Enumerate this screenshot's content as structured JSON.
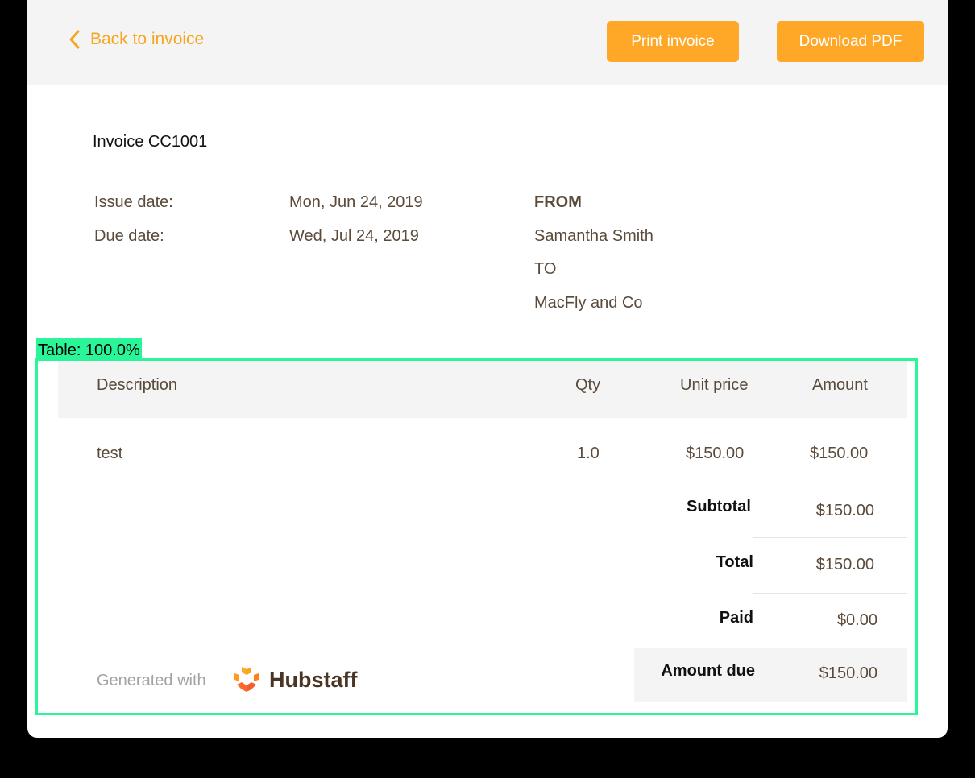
{
  "header": {
    "back_label": "Back to invoice",
    "print_label": "Print invoice",
    "download_label": "Download PDF"
  },
  "invoice": {
    "title": "Invoice CC1001",
    "issue_label": "Issue date:",
    "issue_value": "Mon, Jun 24, 2019",
    "due_label": "Due date:",
    "due_value": "Wed, Jul 24, 2019",
    "from_label": "FROM",
    "from_value": "Samantha Smith",
    "to_label": "TO",
    "to_value": "MacFly and Co"
  },
  "annotation": {
    "label": "Table: 100.0%"
  },
  "table": {
    "headers": [
      "Description",
      "Qty",
      "Unit price",
      "Amount"
    ],
    "rows": [
      {
        "description": "test",
        "qty": "1.0",
        "unit_price": "$150.00",
        "amount": "$150.00"
      }
    ]
  },
  "summary": {
    "subtotal_label": "Subtotal",
    "subtotal_value": "$150.00",
    "total_label": "Total",
    "total_value": "$150.00",
    "paid_label": "Paid",
    "paid_value": "$0.00",
    "due_label": "Amount due",
    "due_value": "$150.00"
  },
  "footer": {
    "generated_label": "Generated with",
    "brand": "Hubstaff"
  },
  "colors": {
    "accent": "#ffa726",
    "link": "#f6a61e",
    "annotation": "#2af598"
  },
  "icons": {
    "back": "chevron-left-icon",
    "logo": "hubstaff-logo-icon"
  }
}
